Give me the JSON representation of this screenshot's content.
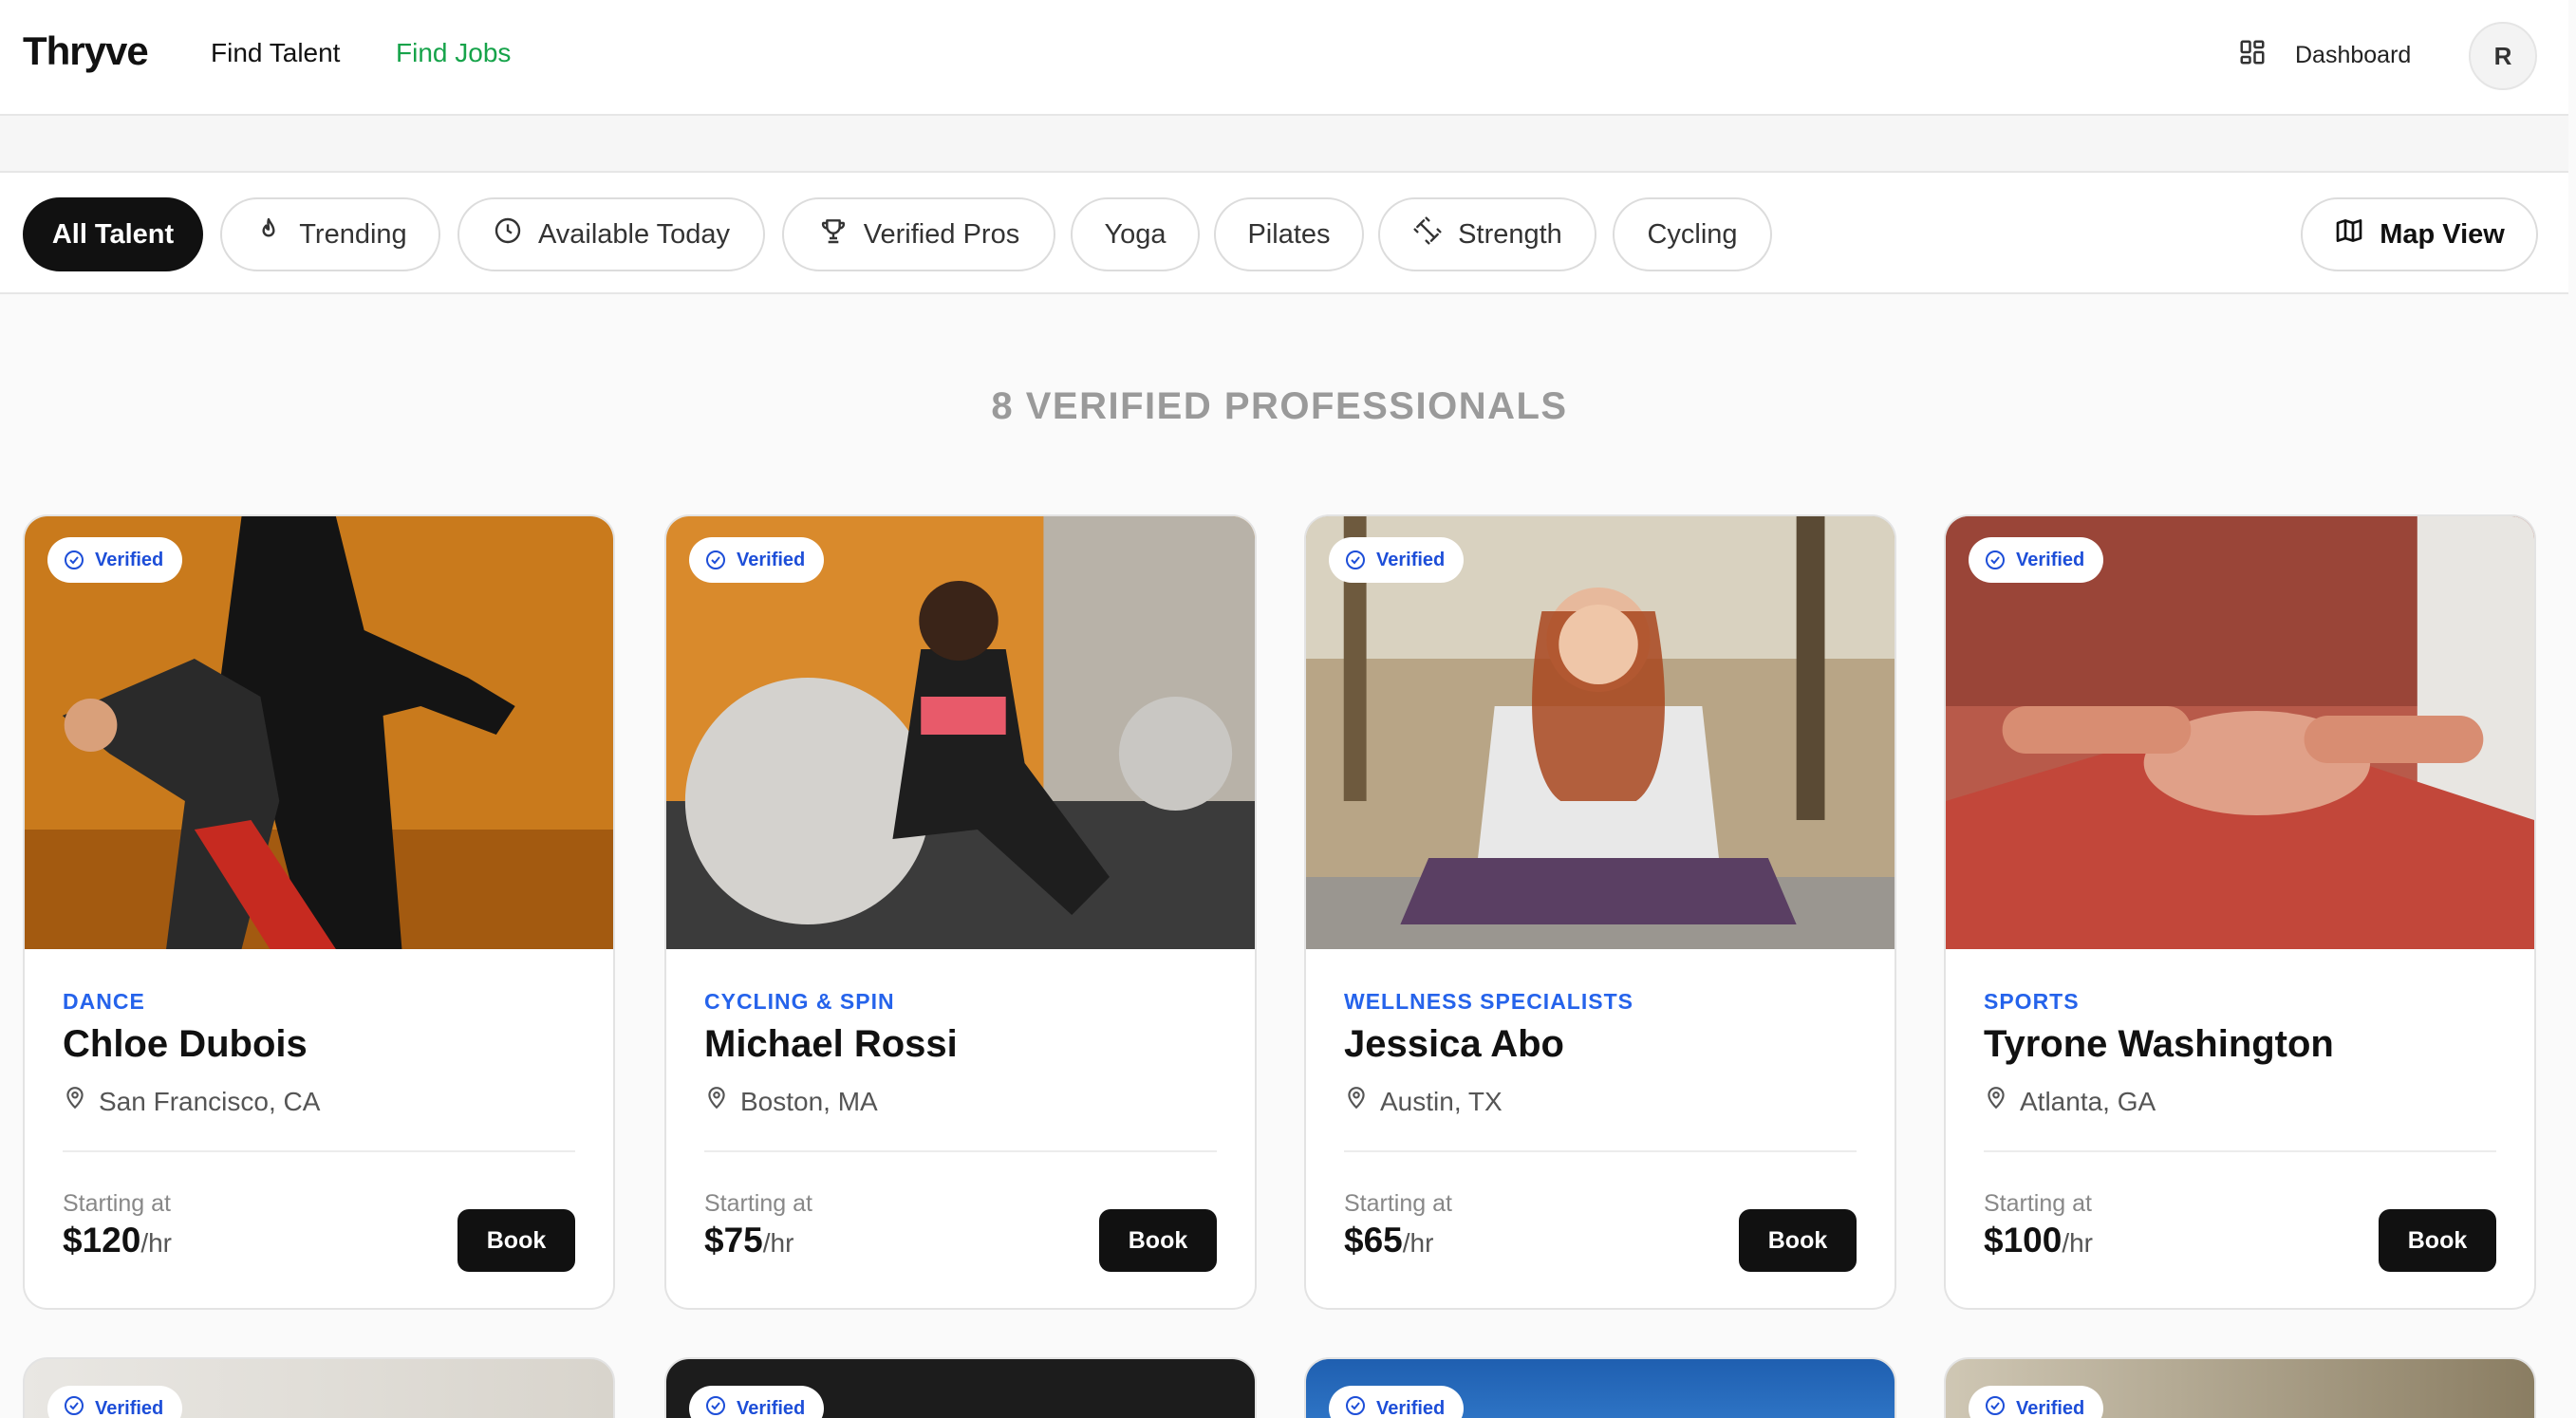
{
  "header": {
    "logo": "Thryve",
    "nav": {
      "find_talent": "Find Talent",
      "find_jobs": "Find Jobs"
    },
    "dashboard_label": "Dashboard",
    "avatar_initial": "R",
    "colors": {
      "find_jobs_active": "#16a34a"
    }
  },
  "filters": {
    "chips": [
      "All Talent",
      "Trending",
      "Available Today",
      "Verified Pros",
      "Yoga",
      "Pilates",
      "Strength",
      "Cycling"
    ],
    "active": "All Talent",
    "map_view": "Map View",
    "icons": {
      "Trending": "flame-icon",
      "Available Today": "clock-icon",
      "Verified Pros": "trophy-icon",
      "Strength": "dumbbell-icon",
      "Map View": "map-icon"
    }
  },
  "results_heading": "8 VERIFIED PROFESSIONALS",
  "cards": [
    {
      "badge": "Verified",
      "category": "Dance",
      "name": "Chloe Dubois",
      "location": "San Francisco, CA",
      "starting_label": "Starting at",
      "price": "$120",
      "per": "/hr",
      "book": "Book"
    },
    {
      "badge": "Verified",
      "category": "Cycling & Spin",
      "name": "Michael Rossi",
      "location": "Boston, MA",
      "starting_label": "Starting at",
      "price": "$75",
      "per": "/hr",
      "book": "Book"
    },
    {
      "badge": "Verified",
      "category": "Wellness Specialists",
      "name": "Jessica Abo",
      "location": "Austin, TX",
      "starting_label": "Starting at",
      "price": "$65",
      "per": "/hr",
      "book": "Book"
    },
    {
      "badge": "Verified",
      "category": "Sports",
      "name": "Tyrone Washington",
      "location": "Atlanta, GA",
      "starting_label": "Starting at",
      "price": "$100",
      "per": "/hr",
      "book": "Book"
    }
  ],
  "peek_cards": [
    {
      "badge": "Verified"
    },
    {
      "badge": "Verified"
    },
    {
      "badge": "Verified"
    },
    {
      "badge": "Verified"
    }
  ],
  "colors": {
    "accent_blue": "#2563eb",
    "primary_dark": "#111111"
  }
}
